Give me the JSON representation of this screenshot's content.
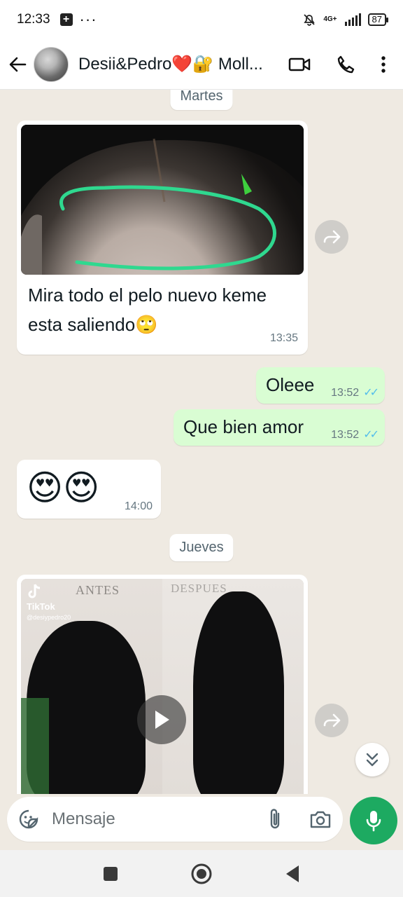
{
  "status_bar": {
    "time": "12:33",
    "network": "4G+",
    "battery": "87"
  },
  "header": {
    "title": "Desii&Pedro❤️🔐 Moll...",
    "avatar_icon": "avatar-photo"
  },
  "messages": [
    {
      "type": "date",
      "text": "Martes"
    },
    {
      "type": "incoming-image",
      "caption": "Mira todo el pelo nuevo keme esta saliendo🙄",
      "time": "13:35"
    },
    {
      "type": "outgoing",
      "text": "Oleee",
      "time": "13:52",
      "status": "read"
    },
    {
      "type": "outgoing",
      "text": "Que bien amor",
      "time": "13:52",
      "status": "read"
    },
    {
      "type": "incoming",
      "text": "😍😍",
      "time": "14:00"
    },
    {
      "type": "date",
      "text": "Jueves"
    },
    {
      "type": "incoming-video",
      "overlay_left": "ANTES",
      "overlay_right": "DESPUES",
      "watermark": "TikTok",
      "watermark_user": "@desiypedro20"
    }
  ],
  "composer": {
    "placeholder": "Mensaje"
  },
  "colors": {
    "outgoing_bubble": "#d9fdd3",
    "incoming_bubble": "#ffffff",
    "chat_background": "#efeae2",
    "mic_button": "#1daa61",
    "read_ticks": "#53bdeb"
  }
}
